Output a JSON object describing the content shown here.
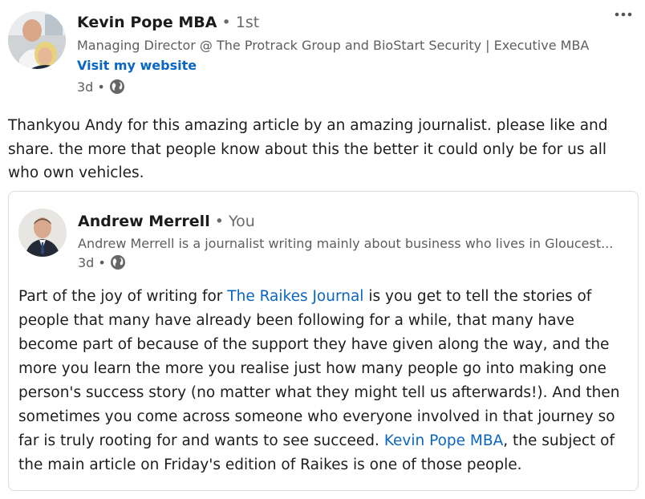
{
  "post": {
    "author": {
      "name": "Kevin Pope MBA",
      "degree": "1st",
      "headline": "Managing Director @ The Protrack Group and BioStart Security | Executive MBA",
      "website_link": "Visit my website",
      "time": "3d"
    },
    "more_icon": "ellipsis-icon",
    "text_lines": [
      "Thankyou Andy for this amazing article by an amazing journalist. please like and",
      "share. the more that people know about this the better it could only be for us all",
      "who own vehicles."
    ]
  },
  "shared": {
    "author": {
      "name": "Andrew Merrell",
      "relation": "You",
      "headline": "Andrew Merrell is a journalist writing mainly about business who lives in Gloucest...",
      "time": "3d"
    },
    "lines": [
      {
        "before": "Part of the joy of writing for ",
        "mention": "The Raikes Journal",
        "after": " is you get to tell the stories of"
      },
      {
        "text": "people that many have already been following for a while, that many have"
      },
      {
        "text": "become part of because of the support they have given along the way, and the"
      },
      {
        "text": "more you learn the more you realise just how many people go into making one"
      },
      {
        "text": "person's success story (no matter what they might tell us afterwards!). And then"
      },
      {
        "text": "sometimes you come across someone who everyone involved in that journey so"
      },
      {
        "before": "far is truly rooting for and wants to see succeed. ",
        "mention": "Kevin Pope MBA",
        "after": ", the subject of"
      },
      {
        "text": "the main article on Friday's edition of Raikes is one of those people."
      }
    ]
  },
  "colors": {
    "link": "#0a66c2",
    "muted": "#5e5e5e",
    "text": "#1d1d1d"
  },
  "separator": "•"
}
